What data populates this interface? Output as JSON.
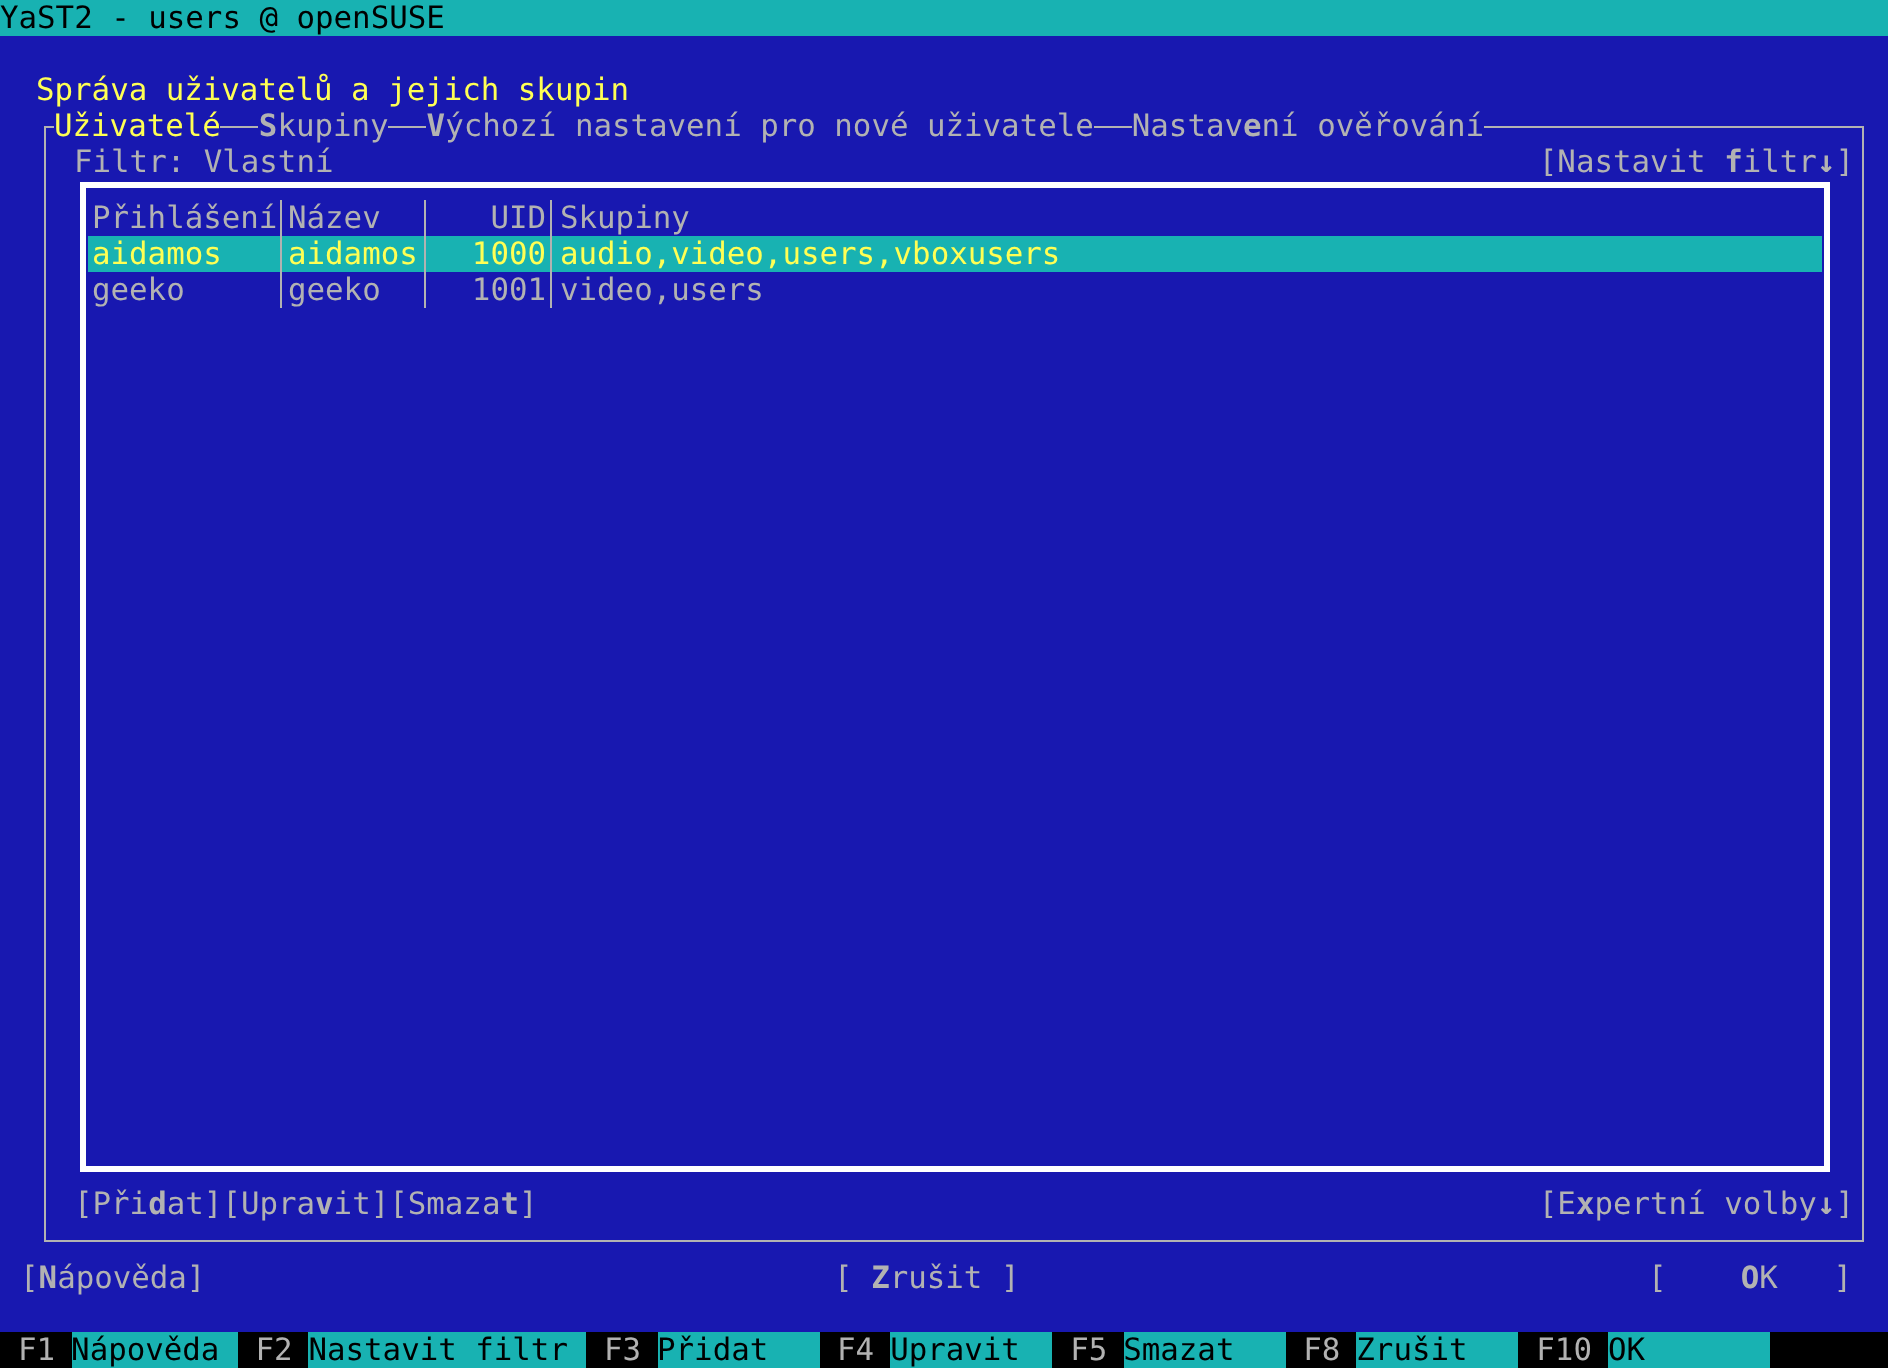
{
  "window": {
    "title": "YaST2 - users @ openSUSE"
  },
  "heading": "Správa uživatelů a jejich skupin",
  "tabs": [
    {
      "label": "Uživatelé",
      "selected": true
    },
    {
      "label": "**S**kupiny",
      "selected": false
    },
    {
      "label": "**V**ýchozí nastavení pro nové uživatele",
      "selected": false
    },
    {
      "label": "Nastav**e**ní ověřování",
      "selected": false
    }
  ],
  "filter": {
    "label": "Filtr: Vlastní",
    "button": "[Nastavit **f**iltr**↓**]"
  },
  "table": {
    "columns": [
      "Přihlášení",
      "Název",
      "UID",
      "Skupiny"
    ],
    "rows": [
      {
        "cells": [
          "aidamos",
          "aidamos",
          "1000",
          "audio,video,users,vboxusers"
        ],
        "selected": true
      },
      {
        "cells": [
          "geeko",
          "geeko",
          "1001",
          "video,users"
        ],
        "selected": false
      }
    ]
  },
  "actions": [
    "[Při**d**at]",
    "[Upra**v**it]",
    "[Smaza**t**]"
  ],
  "expert_button": "[E**x**pertní volby**↓**]",
  "buttons": {
    "help": "[**N**ápověda]",
    "cancel": "[ **Z**rušit ]",
    "ok": "[    **O**K   ]"
  },
  "function_keys": [
    {
      "key": "F1",
      "label": "Nápověda"
    },
    {
      "key": "F2",
      "label": "Nastavit filtr"
    },
    {
      "key": "F3",
      "label": "Přidat"
    },
    {
      "key": "F4",
      "label": "Upravit"
    },
    {
      "key": "F5",
      "label": "Smazat"
    },
    {
      "key": "F8",
      "label": "Zrušit"
    },
    {
      "key": "F10",
      "label": "OK"
    }
  ]
}
